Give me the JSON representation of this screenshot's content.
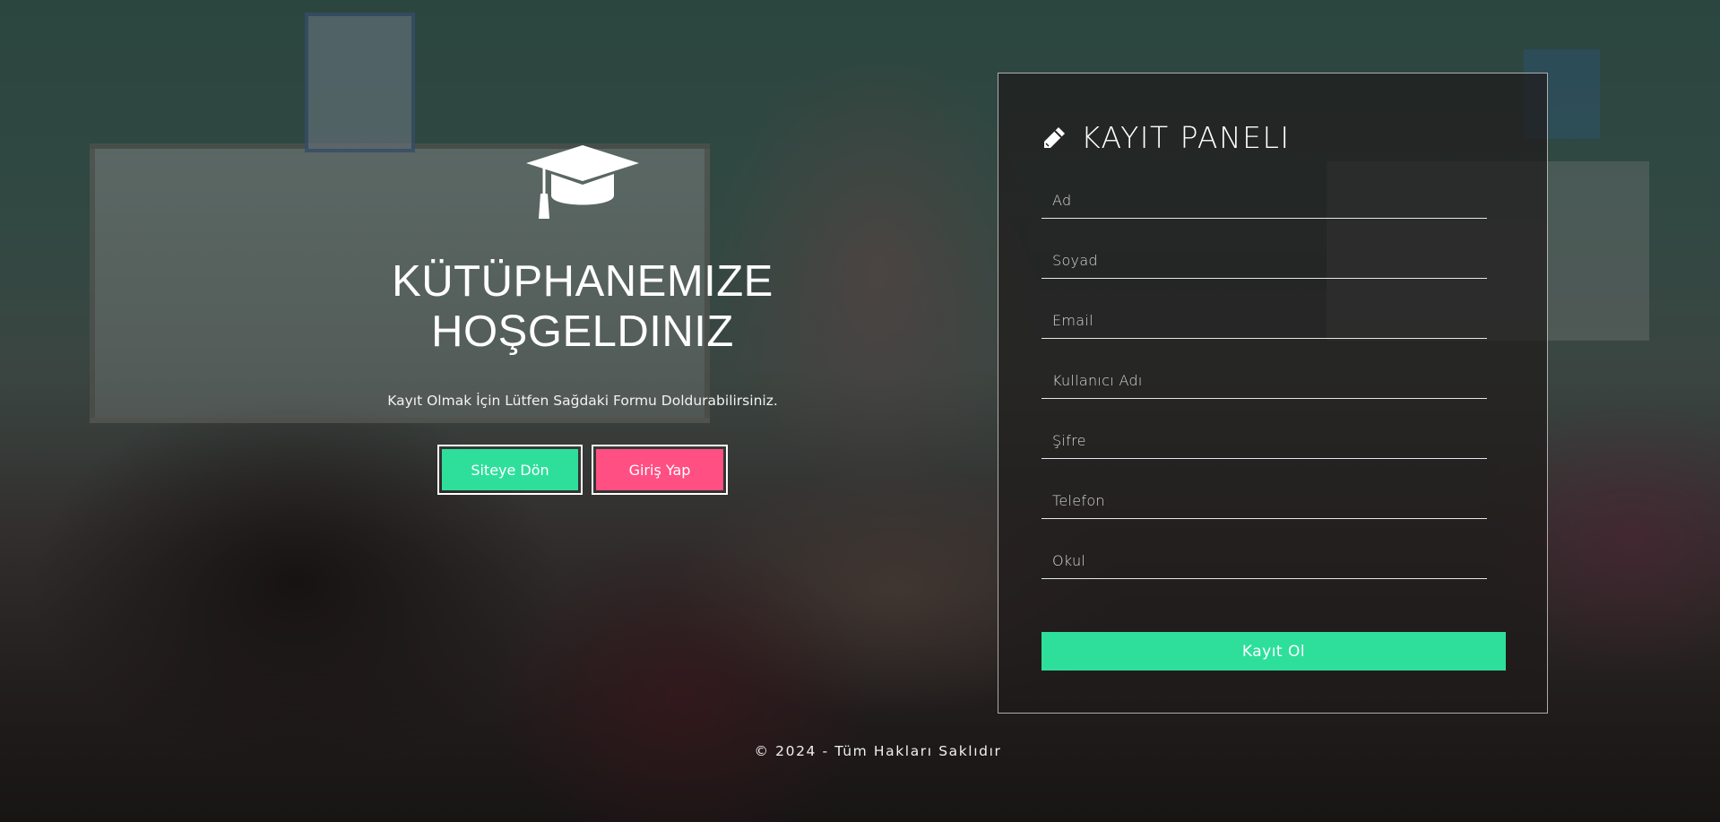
{
  "hero": {
    "icon": "graduation-cap-icon",
    "title": "KÜTÜPHANEMIZE HOŞGELDINIZ",
    "subtitle": "Kayıt Olmak İçin Lütfen Sağdaki Formu Doldurabilirsiniz.",
    "buttons": {
      "back_label": "Siteye Dön",
      "login_label": "Giriş Yap"
    }
  },
  "panel": {
    "icon": "pencil-icon",
    "title": "KAYIT PANELI",
    "fields": [
      {
        "placeholder": "Ad",
        "value": ""
      },
      {
        "placeholder": "Soyad",
        "value": ""
      },
      {
        "placeholder": "Email",
        "value": ""
      },
      {
        "placeholder": "Kullanıcı Adı",
        "value": ""
      },
      {
        "placeholder": "Şifre",
        "value": ""
      },
      {
        "placeholder": "Telefon",
        "value": ""
      },
      {
        "placeholder": "Okul",
        "value": ""
      }
    ],
    "submit_label": "Kayıt Ol"
  },
  "footer": {
    "text": "© 2024 - Tüm Hakları Saklıdır"
  },
  "colors": {
    "accent_green": "#2edf9c",
    "accent_pink": "#ff4f83",
    "panel_border": "#dcdcdc"
  }
}
